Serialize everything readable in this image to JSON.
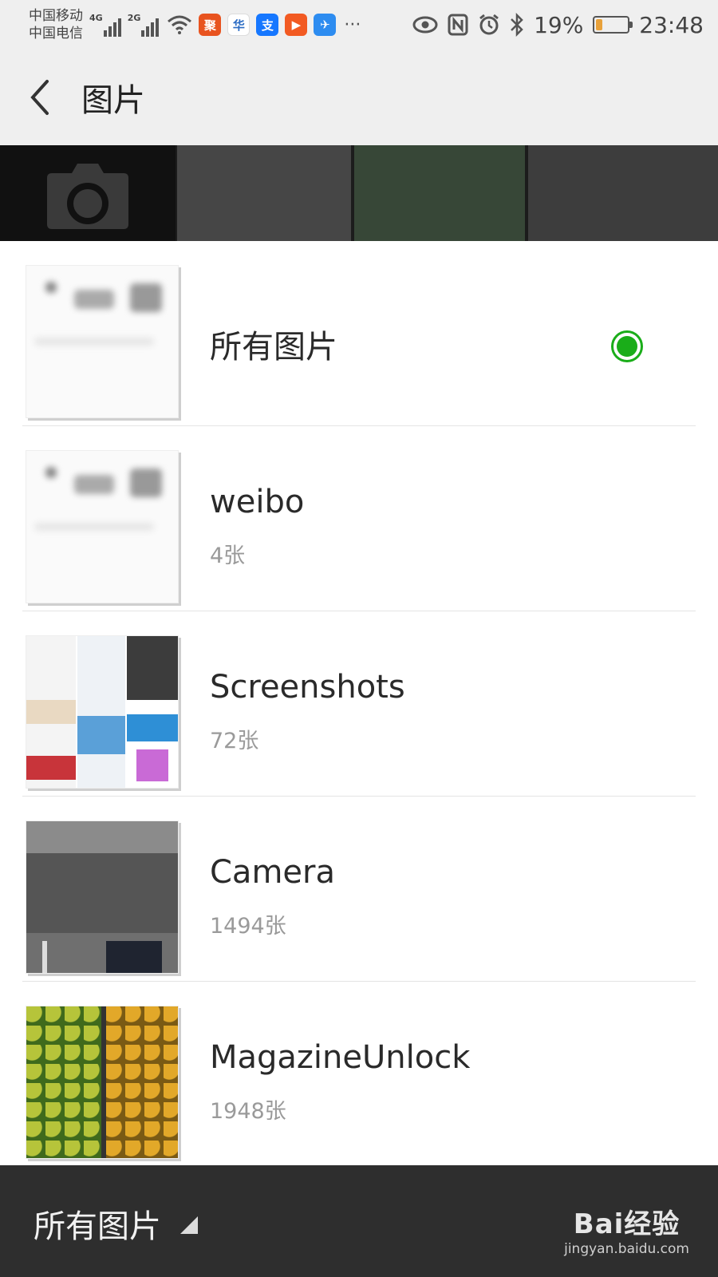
{
  "status_bar": {
    "carrier_1": "中国移动",
    "carrier_2": "中国电信",
    "network_1": "4G",
    "network_2": "2G",
    "battery_level": 0.19,
    "battery_text": "19%",
    "time": "23:48",
    "more": "···"
  },
  "header": {
    "back_icon": "chevron-left-icon",
    "title": "图片"
  },
  "albums": [
    {
      "name": "所有图片",
      "count": "",
      "selected": true
    },
    {
      "name": "weibo",
      "count": "4张",
      "selected": false
    },
    {
      "name": "Screenshots",
      "count": "72张",
      "selected": false
    },
    {
      "name": "Camera",
      "count": "1494张",
      "selected": false
    },
    {
      "name": "MagazineUnlock",
      "count": "1948张",
      "selected": false
    }
  ],
  "bottom_bar": {
    "label": "所有图片",
    "watermark_logo": "Bai经验",
    "watermark_url": "jingyan.baidu.com"
  },
  "colors": {
    "selected_green": "#1aad19",
    "bottom_bar": "#2e2e2e"
  }
}
